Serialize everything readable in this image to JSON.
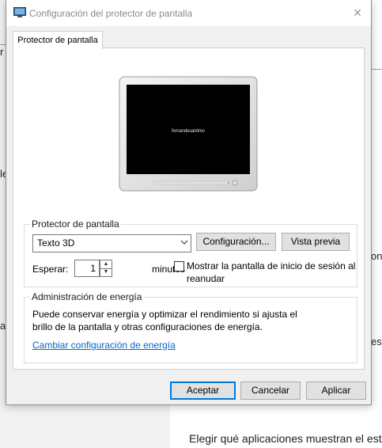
{
  "background": {
    "left_fragments": [
      "r",
      "le",
      "a"
    ],
    "right_fragments": [
      "on",
      "est"
    ],
    "bottom_text": "Elegir qué aplicaciones muestran el esta"
  },
  "dialog": {
    "title": "Configuración del protector de pantalla",
    "close_glyph": "✕",
    "tab_label": "Protector de pantalla",
    "preview_text": "fernandesantimo",
    "screensaver": {
      "group_label": "Protector de pantalla",
      "selected": "Texto 3D",
      "settings_button": "Configuración...",
      "preview_button": "Vista previa",
      "wait_label": "Esperar:",
      "wait_value": "1",
      "minutes_label": "minutos",
      "logon_checkbox_label_line1": "Mostrar la pantalla de inicio de sesión al",
      "logon_checkbox_label_line2": "reanudar",
      "logon_checked": false
    },
    "power": {
      "group_label": "Administración de energía",
      "description_line1": "Puede conservar energía y optimizar el rendimiento si ajusta el",
      "description_line2": "brillo de la pantalla y otras configuraciones de energía.",
      "link_text": "Cambiar configuración de energía"
    },
    "buttons": {
      "accept": "Aceptar",
      "cancel": "Cancelar",
      "apply": "Aplicar"
    }
  },
  "colors": {
    "link": "#0066cc",
    "focus_border": "#0078d7",
    "screen": "#000000"
  }
}
